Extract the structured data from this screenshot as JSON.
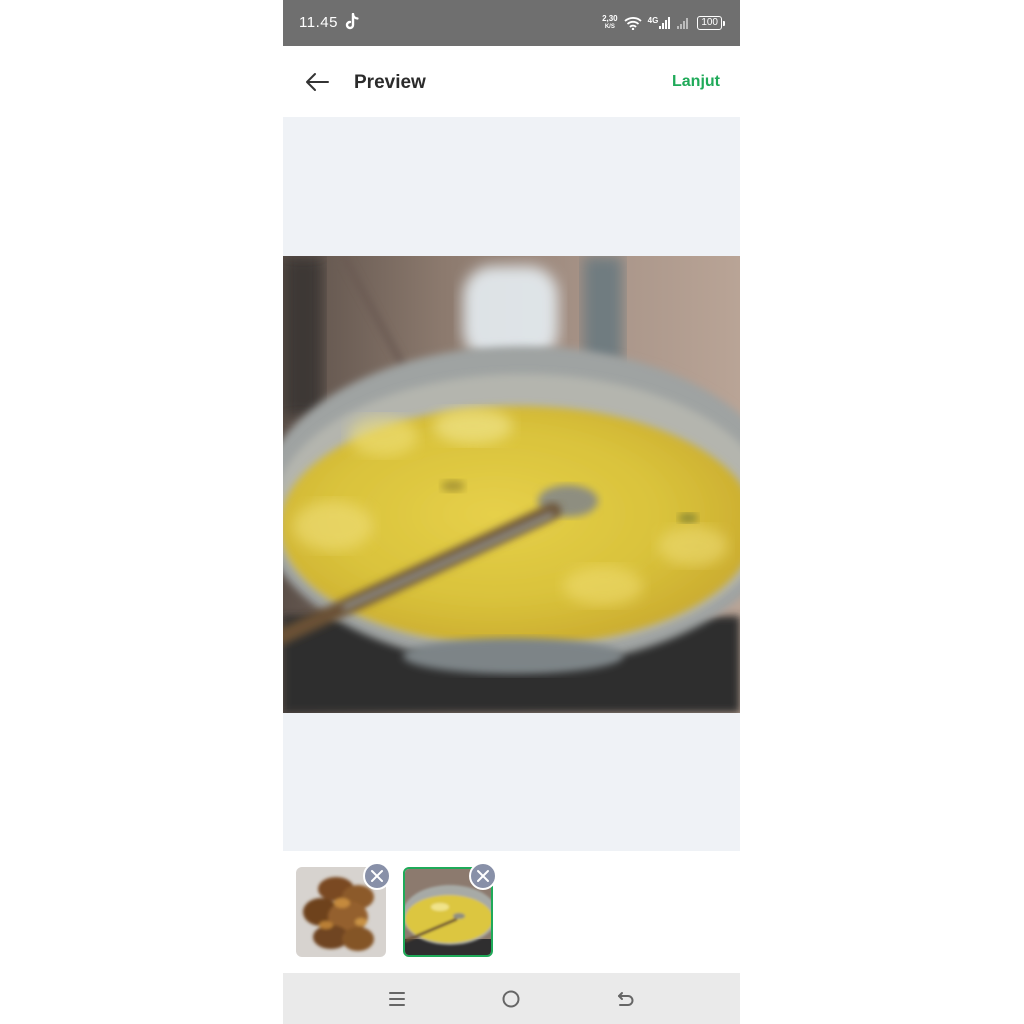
{
  "status_bar": {
    "time": "11.45",
    "net_speed_value": "2,30",
    "net_speed_unit": "K/S",
    "network_type": "4G",
    "battery": "100",
    "icons": [
      "tiktok-icon",
      "wifi-icon",
      "signal-4g-icon",
      "signal-icon",
      "battery-icon"
    ]
  },
  "header": {
    "back_icon": "arrow-left-icon",
    "title": "Preview",
    "next_label": "Lanjut"
  },
  "preview": {
    "image": "yellow-curry-in-wok-photo"
  },
  "thumbnails": [
    {
      "image": "fried-food-photo",
      "selected": false,
      "remove_icon": "close-icon"
    },
    {
      "image": "yellow-curry-in-wok-photo",
      "selected": true,
      "remove_icon": "close-icon"
    }
  ],
  "nav_bar": {
    "icons": [
      "menu-icon",
      "home-icon",
      "back-icon"
    ]
  },
  "colors": {
    "accent": "#1faa59",
    "status_bar": "#6f6f6f",
    "preview_bg": "#eff2f6",
    "remove_button": "#8890a8",
    "nav_bar": "#eaeaea"
  }
}
